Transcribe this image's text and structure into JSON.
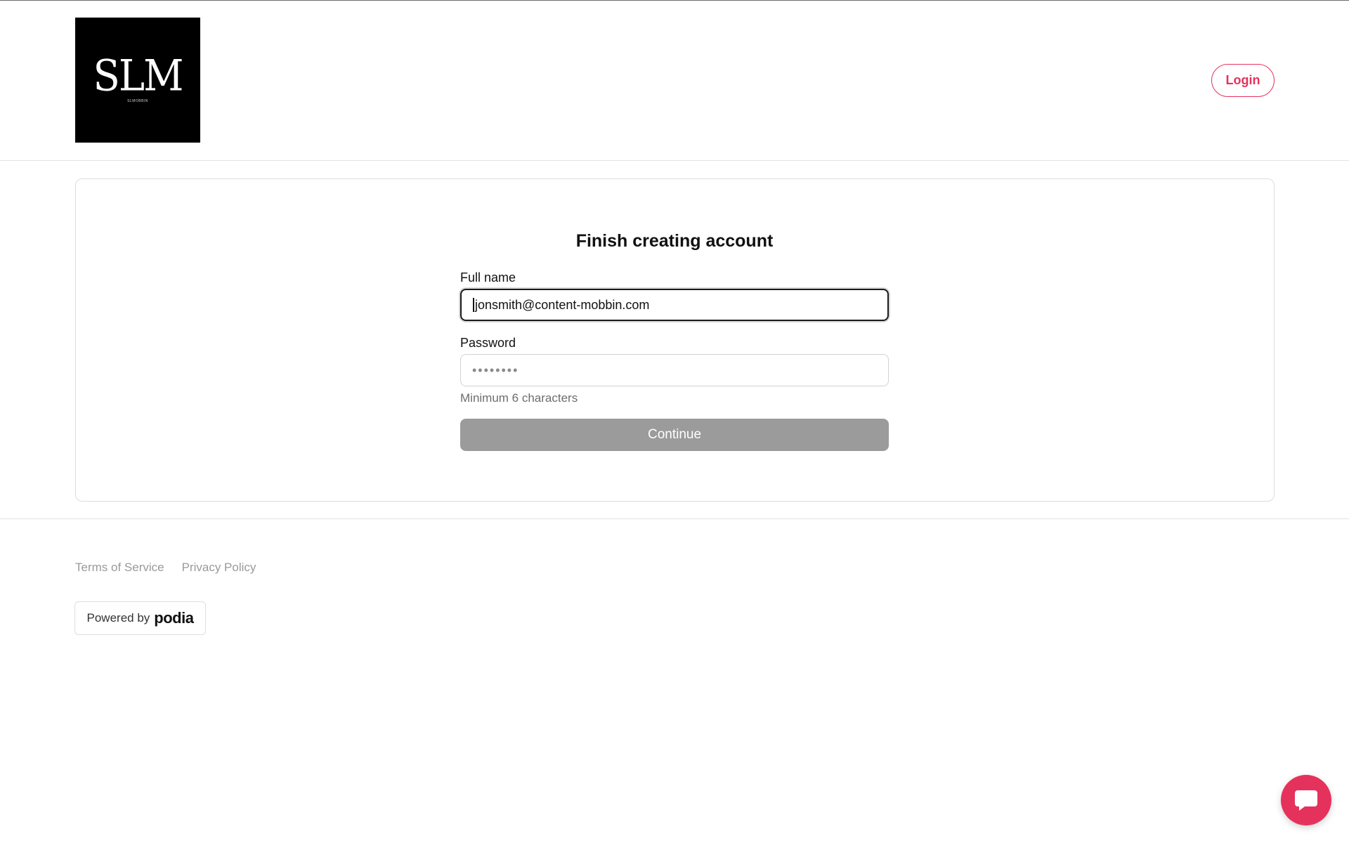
{
  "header": {
    "logo_text": "SLM",
    "logo_subtext": "SLMOBBIN",
    "login_label": "Login"
  },
  "form": {
    "title": "Finish creating account",
    "full_name_label": "Full name",
    "full_name_value": "jonsmith@content-mobbin.com",
    "password_label": "Password",
    "password_value": "••••••••",
    "password_hint": "Minimum 6 characters",
    "continue_label": "Continue"
  },
  "footer": {
    "links": [
      "Terms of Service",
      "Privacy Policy"
    ],
    "powered_prefix": "Powered by",
    "powered_brand": "podia"
  },
  "icons": {
    "chat": "chat-bubble-icon"
  },
  "colors": {
    "accent": "#e5325c",
    "button_disabled": "#9b9b9c"
  }
}
